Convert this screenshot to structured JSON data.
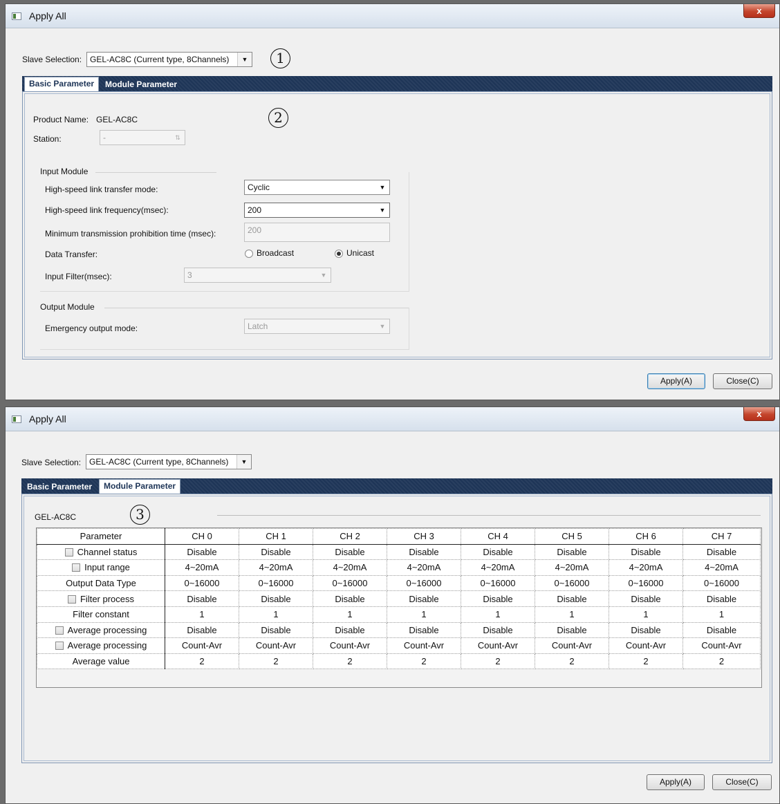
{
  "window1": {
    "title": "Apply All",
    "close_glyph": "x",
    "slave_selection_label": "Slave Selection:",
    "slave_selection_value": "GEL-AC8C (Current type, 8Channels)",
    "marker": "1",
    "tabs": [
      "Basic Parameter",
      "Module Parameter"
    ],
    "active_tab": "Basic Parameter",
    "basic": {
      "marker": "2",
      "product_name_label": "Product Name:",
      "product_name_value": "GEL-AC8C",
      "station_label": "Station:",
      "station_value": "-",
      "input_module_title": "Input Module",
      "transfer_mode_label": "High-speed link transfer mode:",
      "transfer_mode_value": "Cyclic",
      "frequency_label": "High-speed link frequency(msec):",
      "frequency_value": "200",
      "min_prohibition_label": "Minimum transmission prohibition time (msec):",
      "min_prohibition_value": "200",
      "data_transfer_label": "Data Transfer:",
      "data_transfer_options": [
        "Broadcast",
        "Unicast"
      ],
      "data_transfer_selected": "Unicast",
      "input_filter_label": "Input Filter(msec):",
      "input_filter_value": "3",
      "output_module_title": "Output Module",
      "emergency_label": "Emergency output mode:",
      "emergency_value": "Latch"
    },
    "buttons": {
      "apply": "Apply(A)",
      "close": "Close(C)"
    }
  },
  "window2": {
    "title": "Apply All",
    "close_glyph": "x",
    "slave_selection_label": "Slave Selection:",
    "slave_selection_value": "GEL-AC8C (Current type, 8Channels)",
    "tabs": [
      "Basic Parameter",
      "Module Parameter"
    ],
    "active_tab": "Module Parameter",
    "module": {
      "marker": "3",
      "group_title": "GEL-AC8C",
      "columns": [
        "Parameter",
        "CH 0",
        "CH 1",
        "CH 2",
        "CH 3",
        "CH 4",
        "CH 5",
        "CH 6",
        "CH 7"
      ],
      "rows": [
        {
          "param": "Channel status",
          "checkbox": true,
          "values": [
            "Disable",
            "Disable",
            "Disable",
            "Disable",
            "Disable",
            "Disable",
            "Disable",
            "Disable"
          ]
        },
        {
          "param": "Input range",
          "checkbox": true,
          "values": [
            "4~20mA",
            "4~20mA",
            "4~20mA",
            "4~20mA",
            "4~20mA",
            "4~20mA",
            "4~20mA",
            "4~20mA"
          ]
        },
        {
          "param": "Output Data Type",
          "checkbox": false,
          "values": [
            "0~16000",
            "0~16000",
            "0~16000",
            "0~16000",
            "0~16000",
            "0~16000",
            "0~16000",
            "0~16000"
          ]
        },
        {
          "param": "Filter process",
          "checkbox": true,
          "values": [
            "Disable",
            "Disable",
            "Disable",
            "Disable",
            "Disable",
            "Disable",
            "Disable",
            "Disable"
          ]
        },
        {
          "param": "Filter constant",
          "checkbox": false,
          "values": [
            "1",
            "1",
            "1",
            "1",
            "1",
            "1",
            "1",
            "1"
          ]
        },
        {
          "param": "Average processing",
          "checkbox": true,
          "values": [
            "Disable",
            "Disable",
            "Disable",
            "Disable",
            "Disable",
            "Disable",
            "Disable",
            "Disable"
          ]
        },
        {
          "param": "Average processing",
          "checkbox": true,
          "values": [
            "Count-Avr",
            "Count-Avr",
            "Count-Avr",
            "Count-Avr",
            "Count-Avr",
            "Count-Avr",
            "Count-Avr",
            "Count-Avr"
          ]
        },
        {
          "param": "Average value",
          "checkbox": false,
          "values": [
            "2",
            "2",
            "2",
            "2",
            "2",
            "2",
            "2",
            "2"
          ]
        }
      ]
    },
    "buttons": {
      "apply": "Apply(A)",
      "close": "Close(C)"
    }
  },
  "icons": {
    "window_icon": "window-icon",
    "dropdown_arrow": "▼",
    "spin_arrow": "⇅"
  }
}
